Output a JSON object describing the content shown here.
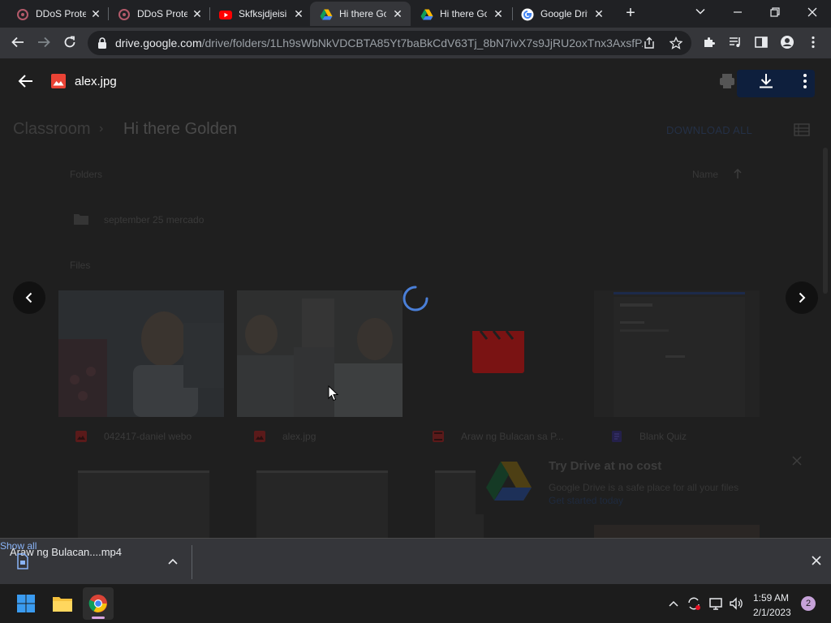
{
  "tabs": [
    {
      "title": "DDoS Prote",
      "icon": "ddos-icon",
      "active": false
    },
    {
      "title": "DDoS Prote",
      "icon": "ddos-icon",
      "active": false
    },
    {
      "title": "Skfksjdjeisi",
      "icon": "youtube-icon",
      "active": false
    },
    {
      "title": "Hi there Go",
      "icon": "drive-icon",
      "active": true
    },
    {
      "title": "Hi there Go",
      "icon": "drive-icon",
      "active": false
    },
    {
      "title": "Google Driv",
      "icon": "google-icon",
      "active": false
    }
  ],
  "address_bar": {
    "host": "drive.google.com",
    "path": "/drive/folders/1Lh9sWbNkVDCBTA85Yt7baBkCdV63Tj_8bN7ivX7s9JjRU2oxTnx3AxsfP..."
  },
  "viewer": {
    "file_name": "alex.jpg"
  },
  "background": {
    "breadcrumb_root": "Classroom",
    "breadcrumb_current": "Hi there Golden",
    "download_all": "DOWNLOAD ALL",
    "folders_label": "Folders",
    "sort_label": "Name",
    "folder_name": "september 25 mercado",
    "files_label": "Files",
    "files": [
      {
        "name": "042417-daniel webo",
        "icon": "image-icon"
      },
      {
        "name": "alex.jpg",
        "icon": "image-icon"
      },
      {
        "name": "Araw ng Bulacan sa P...",
        "icon": "video-icon"
      },
      {
        "name": "Blank Quiz",
        "icon": "forms-icon"
      }
    ],
    "promo_title": "Try Drive at no cost",
    "promo_line1": "Google Drive is a safe place for all your files",
    "promo_line2": "Get started today"
  },
  "downloads": {
    "file": "Araw ng Bulacan....mp4",
    "show_all": "Show all"
  },
  "taskbar": {
    "time": "1:59 AM",
    "date": "2/1/2023",
    "notifications": "2"
  },
  "colors": {
    "accent_blue": "#8ab4f8",
    "spinner": "#4a7fd8",
    "drive_bg": "#1f1f1f"
  }
}
